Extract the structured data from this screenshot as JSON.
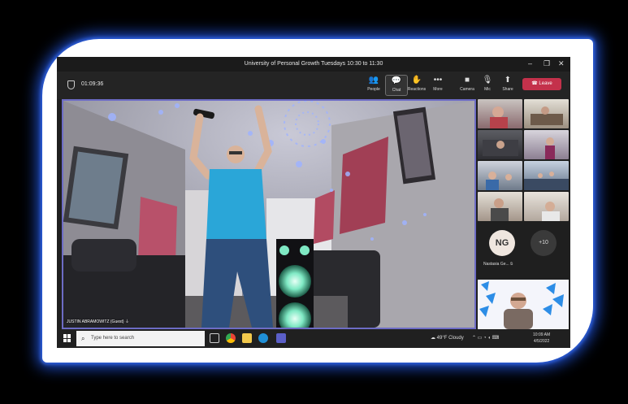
{
  "meeting": {
    "title": "University of Personal Growth Tuesdays 10:30 to 11:30",
    "timer": "01:09:36"
  },
  "toolbar": {
    "people": "People",
    "chat": "Chat",
    "reactions": "Reactions",
    "more": "More",
    "camera": "Camera",
    "mic": "Mic",
    "share": "Share",
    "leave": "Leave"
  },
  "main_video": {
    "speaker_label": "JUSTIN ABRAMOWITZ (Guest)"
  },
  "participants": {
    "initials": "NG",
    "name": "Nastasia Ge...",
    "overflow": "+10"
  },
  "taskbar": {
    "search_placeholder": "Type here to search",
    "weather": "49°F  Cloudy",
    "time": "10:09 AM",
    "date": "4/5/2022"
  },
  "colors": {
    "frame_glow": "#1e4fd0",
    "active_speaker_border": "#6d6cc5",
    "leave_button": "#c4314b"
  }
}
